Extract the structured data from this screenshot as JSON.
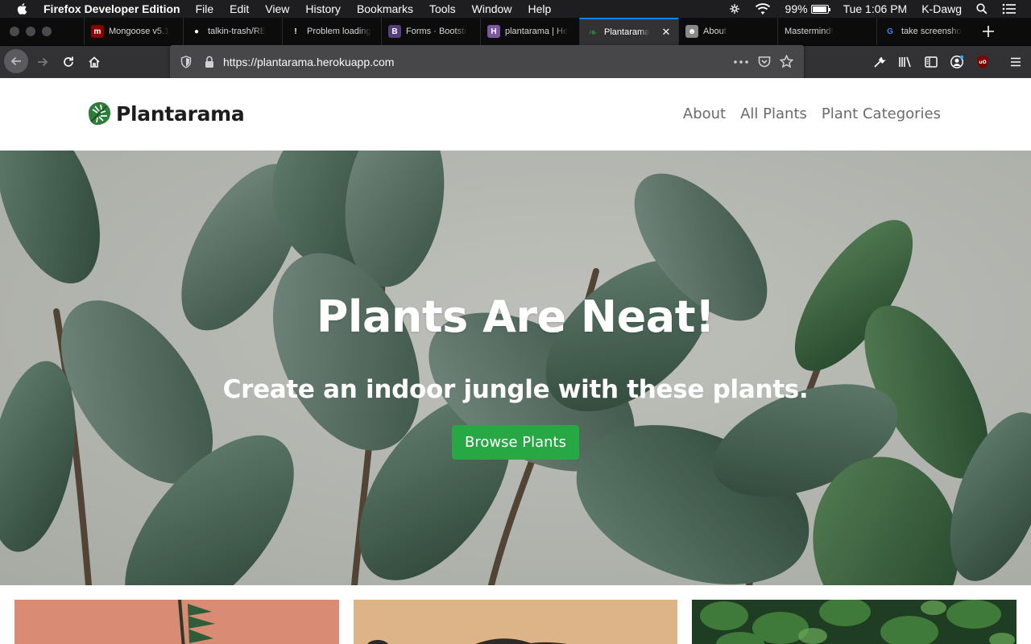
{
  "menubar": {
    "app_name": "Firefox Developer Edition",
    "menus": [
      "File",
      "Edit",
      "View",
      "History",
      "Bookmarks",
      "Tools",
      "Window",
      "Help"
    ],
    "battery_percent": "99%",
    "battery_level": 0.99,
    "clock": "Tue 1:06 PM",
    "user": "K-Dawg"
  },
  "tabs": [
    {
      "title": "Mongoose v5.1",
      "favicon": "mongoose-icon",
      "favicon_color": "#880000"
    },
    {
      "title": "talkin-trash/RE",
      "favicon": "github-icon",
      "favicon_color": "#ffffff"
    },
    {
      "title": "Problem loading",
      "favicon": "warning-icon",
      "favicon_color": "#ffffff"
    },
    {
      "title": "Forms · Bootstr",
      "favicon": "bootstrap-icon",
      "favicon_color": "#563d7c"
    },
    {
      "title": "plantarama | He",
      "favicon": "heroku-icon",
      "favicon_color": "#79589f"
    },
    {
      "title": "Plantarama",
      "favicon": "leaf-icon",
      "favicon_color": "#2e7d32",
      "active": true
    },
    {
      "title": "About",
      "favicon": "raccoon-icon",
      "favicon_color": "#888888"
    },
    {
      "title": "Mastermind!",
      "favicon": "",
      "favicon_color": ""
    },
    {
      "title": "take screensho",
      "favicon": "google-icon",
      "favicon_color": "#4285f4"
    }
  ],
  "urlbar": {
    "url": "https://plantarama.herokuapp.com"
  },
  "site": {
    "brand": "Plantarama",
    "nav": [
      "About",
      "All Plants",
      "Plant Categories"
    ],
    "hero_title": "Plants Are Neat!",
    "hero_subtitle": "Create an indoor jungle with these plants.",
    "hero_button": "Browse Plants",
    "accent_color": "#28a745"
  }
}
